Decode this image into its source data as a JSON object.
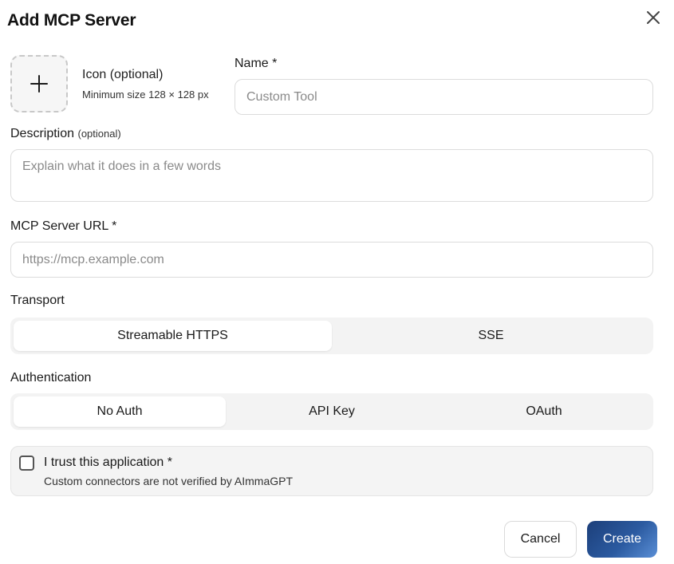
{
  "dialog": {
    "title": "Add MCP Server"
  },
  "icon": {
    "label": "Icon (optional)",
    "hint": "Minimum size 128 × 128 px"
  },
  "name": {
    "label": "Name *",
    "placeholder": "Custom Tool",
    "value": ""
  },
  "description": {
    "label": "Description",
    "optional": "(optional)",
    "placeholder": "Explain what it does in a few words",
    "value": ""
  },
  "server_url": {
    "label": "MCP Server URL *",
    "placeholder": "https://mcp.example.com",
    "value": ""
  },
  "transport": {
    "label": "Transport",
    "options": [
      "Streamable HTTPS",
      "SSE"
    ],
    "selected": "Streamable HTTPS"
  },
  "authentication": {
    "label": "Authentication",
    "options": [
      "No Auth",
      "API Key",
      "OAuth"
    ],
    "selected": "No Auth"
  },
  "trust": {
    "title": "I trust this application *",
    "subtitle": "Custom connectors are not verified by AImmaGPT",
    "checked": false
  },
  "actions": {
    "cancel_label": "Cancel",
    "create_label": "Create"
  },
  "colors": {
    "create_gradient_start": "#1c3f7a",
    "create_gradient_end": "#5a8fd6",
    "segment_background": "#f3f3f3"
  }
}
